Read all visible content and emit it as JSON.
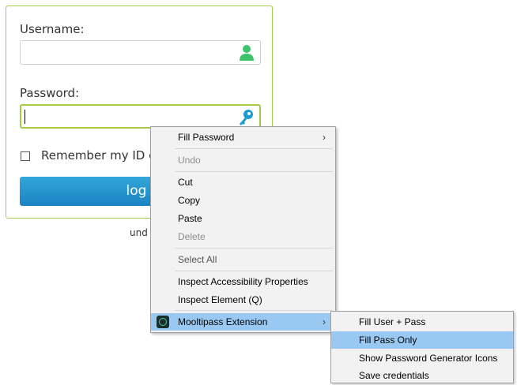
{
  "login": {
    "username_label": "Username:",
    "password_label": "Password:",
    "username_value": "",
    "password_value": "",
    "remember_label": "Remember my ID c",
    "login_button": "log i",
    "below_text": "und"
  },
  "context_menu": {
    "items": [
      {
        "label": "Fill Password",
        "disabled": false,
        "submenu": true
      },
      {
        "label": "Undo",
        "disabled": true
      },
      {
        "label": "Cut",
        "disabled": false
      },
      {
        "label": "Copy",
        "disabled": false
      },
      {
        "label": "Paste",
        "disabled": false
      },
      {
        "label": "Delete",
        "disabled": true
      },
      {
        "label": "Select All",
        "disabled": false
      },
      {
        "label": "Inspect Accessibility Properties",
        "disabled": false
      },
      {
        "label": "Inspect Element (Q)",
        "disabled": false
      },
      {
        "label": "Mooltipass Extension",
        "disabled": false,
        "submenu": true,
        "highlighted": true,
        "icon": "mooltipass-icon"
      }
    ],
    "arrow_glyph": "›"
  },
  "submenu": {
    "items": [
      {
        "label": "Fill User + Pass"
      },
      {
        "label": "Fill Pass Only",
        "highlighted": true
      },
      {
        "label": "Show Password Generator Icons"
      },
      {
        "label": "Save credentials"
      }
    ]
  },
  "colors": {
    "panel_border": "#a6cc47",
    "button": "#1a84c4",
    "user_icon": "#3fc46e",
    "key_icon": "#1a9bd1",
    "highlight": "#99c9f2"
  }
}
